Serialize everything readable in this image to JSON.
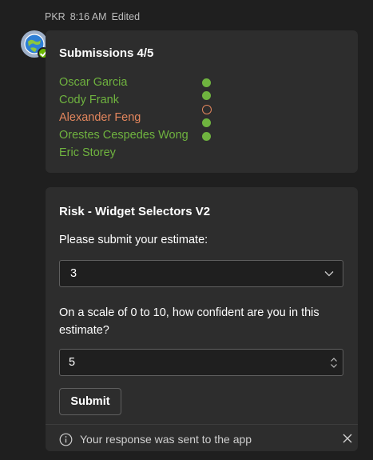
{
  "message": {
    "sender": "PKR",
    "time": "8:16 AM",
    "edited_label": "Edited"
  },
  "submissions_card": {
    "title": "Submissions 4/5",
    "rows": [
      {
        "name": "Oscar Garcia",
        "status": "submitted"
      },
      {
        "name": "Cody Frank",
        "status": "submitted"
      },
      {
        "name": "Alexander Feng",
        "status": "pending"
      },
      {
        "name": "Orestes Cespedes Wong",
        "status": "submitted"
      },
      {
        "name": "Eric Storey",
        "status": "submitted"
      }
    ],
    "colors": {
      "submitted": "#6fb33f",
      "pending": "#e3865d"
    }
  },
  "estimate_card": {
    "title": "Risk - Widget Selectors V2",
    "estimate_prompt": "Please submit your estimate:",
    "estimate_value": "3",
    "confidence_prompt": "On a scale of 0 to 10, how confident are you in this estimate?",
    "confidence_value": "5",
    "submit_label": "Submit",
    "response_message": "Your response was sent to the app"
  },
  "icons": {
    "avatar": "bot-avatar-icon",
    "presence": "available-presence-icon",
    "select_chevron": "chevron-down-icon",
    "stepper_up": "chevron-up-icon",
    "stepper_down": "chevron-down-icon",
    "info": "info-icon",
    "close": "close-icon"
  }
}
